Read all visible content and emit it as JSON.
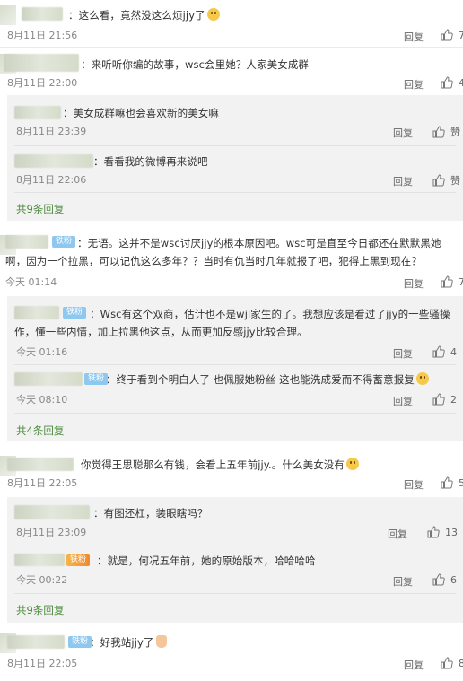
{
  "ui": {
    "reply_label": "回复",
    "like_label": "赞"
  },
  "comments": [
    {
      "text": "：这么看，竟然没这么烦jjy了",
      "time": "8月11日 21:56",
      "likes": "7"
    },
    {
      "text": "：来听听你编的故事，wsc会里她？人家美女成群",
      "time": "8月11日 22:00",
      "likes": "4",
      "replies": [
        {
          "text": "：美女成群嘛也会喜欢新的美女嘛",
          "time": "8月11日 23:39",
          "likes": "赞"
        },
        {
          "text": "：看看我的微博再来说吧",
          "time": "8月11日 22:06",
          "likes": "赞"
        }
      ],
      "more": "共9条回复"
    },
    {
      "badge": "铁粉",
      "text": "：无语。这并不是wsc讨厌jjy的根本原因吧。wsc可是直至今日都还在默默黑她啊，因为一个拉黑，可以记仇这么多年？？当时有仇当时几年就报了吧，犯得上黑到现在？",
      "time": "今天 01:14",
      "likes": "7",
      "replies": [
        {
          "badge": "铁粉",
          "text": "：Wsc有这个双商，估计也不是wjl家生的了。我想应该是看过了jjy的一些骚操作，懂一些内情，加上拉黑他这点，从而更加反感jjy比较合理。",
          "time": "今天 01:16",
          "likes": "4"
        },
        {
          "badge": "铁粉",
          "text": "：终于看到个明白人了 也佩服她粉丝 这也能洗成爱而不得蓄意报复",
          "time": "今天 08:10",
          "likes": "2"
        }
      ],
      "more": "共4条回复"
    },
    {
      "text": "你觉得王思聪那么有钱，会看上五年前jjy.。什么美女没有",
      "time": "8月11日 22:05",
      "likes": "5",
      "replies": [
        {
          "text": "：有图还杠，装眼瞎吗？",
          "time": "8月11日 23:09",
          "likes": "13"
        },
        {
          "badge": "铁粉",
          "text": "：就是，何况五年前，她的原始版本，哈哈哈哈",
          "time": "今天 00:22",
          "likes": "6"
        }
      ],
      "more": "共9条回复"
    },
    {
      "badge": "铁粉",
      "text": "：好我站jjy了",
      "time": "8月11日 22:05",
      "likes": "8"
    }
  ]
}
